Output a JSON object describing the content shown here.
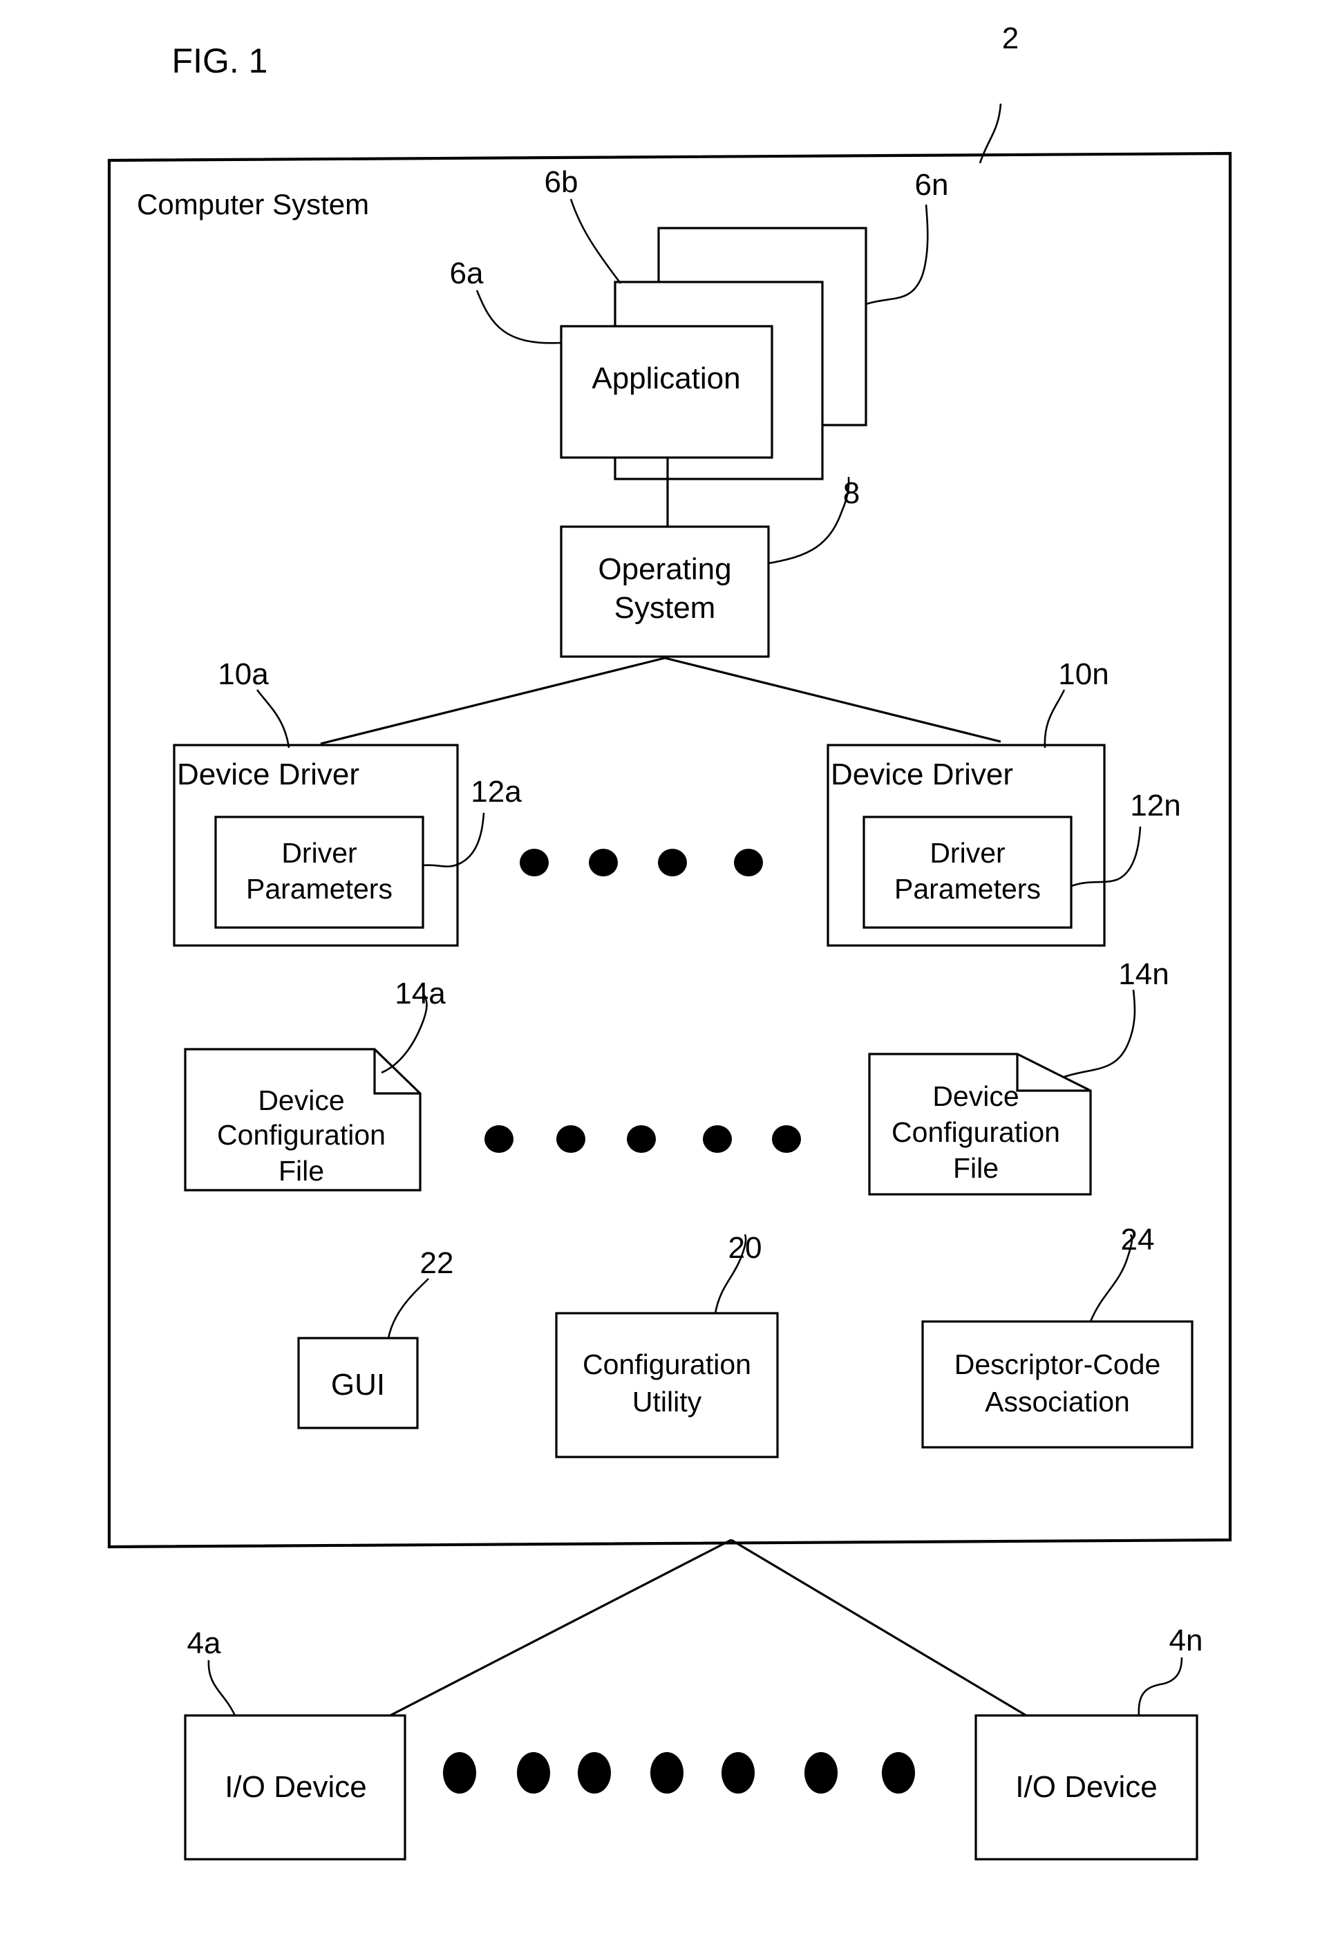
{
  "figure": {
    "title": "FIG. 1",
    "system_label": "Computer System",
    "system_ref": "2"
  },
  "nodes": {
    "application": {
      "label": "Application",
      "refs": {
        "front": "6a",
        "middle": "6b",
        "back": "6n"
      }
    },
    "operating_system": {
      "line1": "Operating",
      "line2": "System",
      "ref": "8"
    },
    "device_driver_left": {
      "label": "Device Driver",
      "ref": "10a",
      "params_line1": "Driver",
      "params_line2": "Parameters",
      "params_ref": "12a"
    },
    "device_driver_right": {
      "label": "Device Driver",
      "ref": "10n",
      "params_line1": "Driver",
      "params_line2": "Parameters",
      "params_ref": "12n"
    },
    "config_file_left": {
      "line1": "Device",
      "line2": "Configuration",
      "line3": "File",
      "ref": "14a"
    },
    "config_file_right": {
      "line1": "Device",
      "line2": "Configuration",
      "line3": "File",
      "ref": "14n"
    },
    "gui": {
      "label": "GUI",
      "ref": "22"
    },
    "configuration_utility": {
      "line1": "Configuration",
      "line2": "Utility",
      "ref": "20"
    },
    "descriptor_code_association": {
      "line1": "Descriptor-Code",
      "line2": "Association",
      "ref": "24"
    },
    "io_device_left": {
      "label": "I/O Device",
      "ref": "4a"
    },
    "io_device_right": {
      "label": "I/O Device",
      "ref": "4n"
    }
  },
  "ellipses": {
    "driver_row_dots": 4,
    "config_row_dots": 5,
    "io_row_dots": 7
  },
  "colors": {
    "stroke": "#000000",
    "fill": "#ffffff",
    "text": "#000000"
  }
}
